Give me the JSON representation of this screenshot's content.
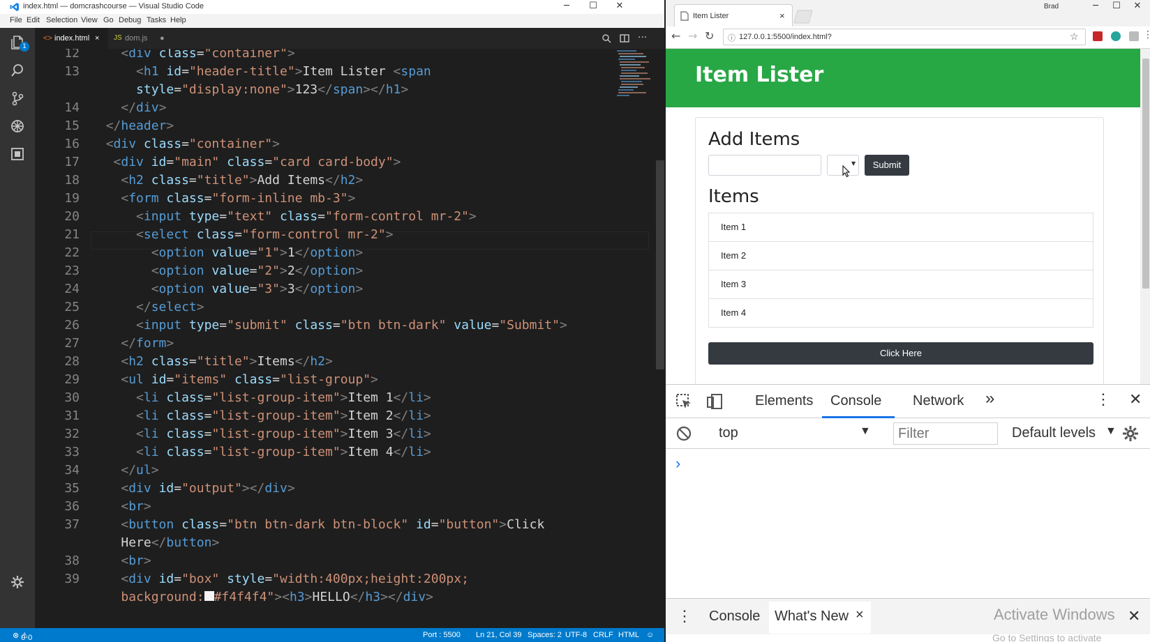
{
  "vscode": {
    "window_title": "index.html — domcrashcourse — Visual Studio Code",
    "menu": [
      "File",
      "Edit",
      "Selection",
      "View",
      "Go",
      "Debug",
      "Tasks",
      "Help"
    ],
    "explorer_badge": "1",
    "tabs": [
      {
        "label": "index.html",
        "close": "×"
      },
      {
        "label": "dom.js",
        "close": "●"
      }
    ],
    "line_numbers": [
      "12",
      "13",
      "",
      "14",
      "15",
      "16",
      "17",
      "18",
      "19",
      "20",
      "21",
      "22",
      "23",
      "24",
      "25",
      "26",
      "27",
      "28",
      "29",
      "30",
      "31",
      "32",
      "33",
      "34",
      "35",
      "36",
      "37",
      "",
      "38",
      "39"
    ],
    "status": {
      "errors": "0",
      "warnings": "0",
      "port": "Port : 5500",
      "position": "Ln 21, Col 39",
      "spaces": "Spaces: 2",
      "encoding": "UTF-8",
      "eol": "CRLF",
      "language": "HTML"
    },
    "colors": {
      "status_bar": "#007acc",
      "activity_bar": "#333333",
      "editor_bg": "#1e1e1e"
    }
  },
  "browser": {
    "tab_title": "Item Lister",
    "tab_close": "×",
    "profile_name": "Brad",
    "url": "127.0.0.1:5500/index.html?",
    "page": {
      "header_title": "Item Lister",
      "add_items_heading": "Add Items",
      "text_input_value": "",
      "select_value": "",
      "submit_label": "Submit",
      "items_heading": "Items",
      "items": [
        "Item 1",
        "Item 2",
        "Item 3",
        "Item 4"
      ],
      "click_button_label": "Click Here"
    },
    "devtools": {
      "tabs": [
        "Elements",
        "Console",
        "Network"
      ],
      "active_tab": "Console",
      "more": "»",
      "context": "top",
      "filter_placeholder": "Filter",
      "levels": "Default levels",
      "prompt": "›",
      "drawer_tabs": [
        "Console",
        "What's New"
      ],
      "drawer_close": "×",
      "watermark_line1": "Activate Windows",
      "watermark_line2": "Go to Settings to activate"
    },
    "colors": {
      "header_green": "#28a745",
      "btn_dark": "#343a40",
      "devtools_accent": "#1a73e8"
    }
  }
}
